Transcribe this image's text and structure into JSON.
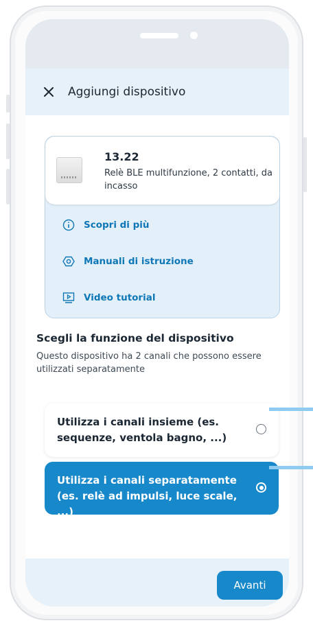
{
  "header": {
    "title": "Aggiungi dispositivo",
    "close_icon": "close-icon"
  },
  "product": {
    "code": "13.22",
    "description": "Relè BLE multifunzione, 2 contatti, da incasso"
  },
  "links": [
    {
      "label": "Scopri di più",
      "icon": "info-icon"
    },
    {
      "label": "Manuali di istruzione",
      "icon": "manual-icon"
    },
    {
      "label": "Video tutorial",
      "icon": "video-icon"
    }
  ],
  "function_section": {
    "title": "Scegli la funzione del dispositivo",
    "description": "Questo dispositivo ha 2 canali che possono essere utilizzati separatamente",
    "options": [
      {
        "label": "Utilizza i canali insieme (es. sequenze, ventola bagno, ...)",
        "selected": false
      },
      {
        "label": "Utilizza i canali separatamente (es. relè ad impulsi, luce scale, ...)",
        "selected": true
      }
    ]
  },
  "footer": {
    "next_label": "Avanti"
  },
  "colors": {
    "accent": "#1788c9",
    "link": "#0e77b7",
    "background": "#e6f1f9",
    "callout": "#8fcbf0"
  }
}
